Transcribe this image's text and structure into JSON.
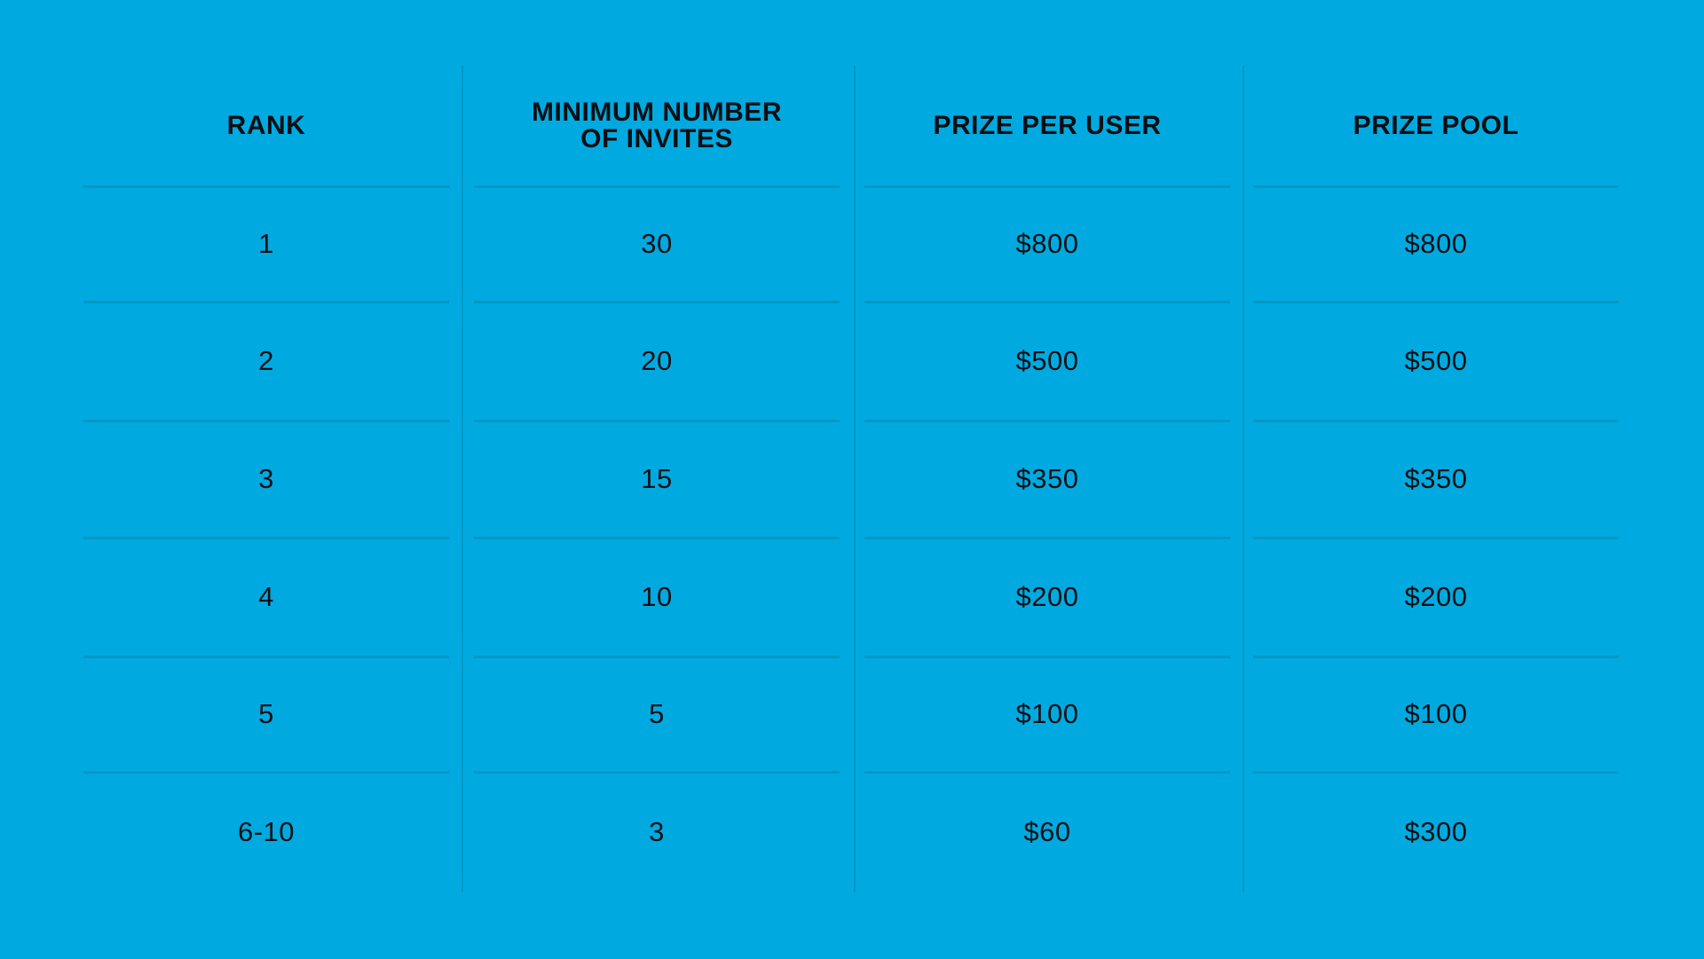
{
  "colors": {
    "background": "#00aae0",
    "divider": "#0796c6",
    "text": "#0a0f14"
  },
  "table": {
    "headers": {
      "rank": "RANK",
      "min_invites": "MINIMUM NUMBER OF INVITES",
      "prize_per_user": "PRIZE PER USER",
      "prize_pool": "PRIZE POOL"
    },
    "rows": [
      {
        "rank": "1",
        "min_invites": "30",
        "prize_per_user": "$800",
        "prize_pool": "$800"
      },
      {
        "rank": "2",
        "min_invites": "20",
        "prize_per_user": "$500",
        "prize_pool": "$500"
      },
      {
        "rank": "3",
        "min_invites": "15",
        "prize_per_user": "$350",
        "prize_pool": "$350"
      },
      {
        "rank": "4",
        "min_invites": "10",
        "prize_per_user": "$200",
        "prize_pool": "$200"
      },
      {
        "rank": "5",
        "min_invites": "5",
        "prize_per_user": "$100",
        "prize_pool": "$100"
      },
      {
        "rank": "6-10",
        "min_invites": "3",
        "prize_per_user": "$60",
        "prize_pool": "$300"
      }
    ]
  }
}
